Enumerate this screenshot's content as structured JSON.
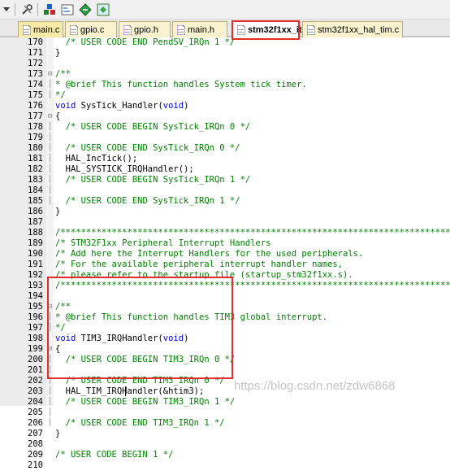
{
  "toolbar": {
    "buttons": [
      "dropdown-arrow",
      "tools-icon",
      "manage-components-icon",
      "layout-icon",
      "diamond-icon",
      "extension-icon"
    ]
  },
  "tabs": [
    {
      "label": "main.c",
      "type": "c"
    },
    {
      "label": "gpio.c",
      "type": "c"
    },
    {
      "label": "gpio.h",
      "type": "h"
    },
    {
      "label": "main.h",
      "type": "h"
    },
    {
      "label": "stm32f1xx_it.c",
      "type": "c",
      "active": true
    },
    {
      "label": "stm32f1xx_hal_tim.c",
      "type": "c"
    }
  ],
  "lines": [
    {
      "n": "170",
      "text": "  /* USER CODE END PendSV_IRQn 1 */"
    },
    {
      "n": "171",
      "text": "}"
    },
    {
      "n": "172",
      "text": ""
    },
    {
      "n": "173",
      "text": "/**"
    },
    {
      "n": "174",
      "text": "* @brief This function handles System tick timer."
    },
    {
      "n": "175",
      "text": "*/"
    },
    {
      "n": "176",
      "text": "void SysTick_Handler(void)"
    },
    {
      "n": "177",
      "text": "{"
    },
    {
      "n": "178",
      "text": "  /* USER CODE BEGIN SysTick_IRQn 0 */"
    },
    {
      "n": "179",
      "text": ""
    },
    {
      "n": "180",
      "text": "  /* USER CODE END SysTick_IRQn 0 */"
    },
    {
      "n": "181",
      "text": "  HAL_IncTick();"
    },
    {
      "n": "182",
      "text": "  HAL_SYSTICK_IRQHandler();"
    },
    {
      "n": "183",
      "text": "  /* USER CODE BEGIN SysTick_IRQn 1 */"
    },
    {
      "n": "184",
      "text": ""
    },
    {
      "n": "185",
      "text": "  /* USER CODE END SysTick_IRQn 1 */"
    },
    {
      "n": "186",
      "text": "}"
    },
    {
      "n": "187",
      "text": ""
    },
    {
      "n": "188",
      "text": "/******************************************************************************/"
    },
    {
      "n": "189",
      "text": "/* STM32F1xx Peripheral Interrupt Handlers                                    */"
    },
    {
      "n": "190",
      "text": "/* Add here the Interrupt Handlers for the used peripherals.                  */"
    },
    {
      "n": "191",
      "text": "/* For the available peripheral interrupt handler names,                      */"
    },
    {
      "n": "192",
      "text": "/* please refer to the startup file (startup_stm32f1xx.s).                    */"
    },
    {
      "n": "193",
      "text": "/******************************************************************************/"
    },
    {
      "n": "194",
      "text": ""
    },
    {
      "n": "195",
      "text": "/**"
    },
    {
      "n": "196",
      "text": "* @brief This function handles TIM3 global interrupt."
    },
    {
      "n": "197",
      "text": "*/"
    },
    {
      "n": "198",
      "text": "void TIM3_IRQHandler(void)"
    },
    {
      "n": "199",
      "text": "{"
    },
    {
      "n": "200",
      "text": "  /* USER CODE BEGIN TIM3_IRQn 0 */"
    },
    {
      "n": "201",
      "text": ""
    },
    {
      "n": "202",
      "text": "  /* USER CODE END TIM3_IRQn 0 */"
    },
    {
      "n": "203",
      "text": "  HAL_TIM_IRQHandler(&htim3);"
    },
    {
      "n": "204",
      "text": "  /* USER CODE BEGIN TIM3_IRQn 1 */"
    },
    {
      "n": "205",
      "text": ""
    },
    {
      "n": "206",
      "text": "  /* USER CODE END TIM3_IRQn 1 */"
    },
    {
      "n": "207",
      "text": "}"
    },
    {
      "n": "208",
      "text": ""
    },
    {
      "n": "209",
      "text": "/* USER CODE BEGIN 1 */"
    },
    {
      "n": "210",
      "text": ""
    }
  ],
  "watermark": "https://blog.csdn.net/zdw6868",
  "colors": {
    "comment": "#008000",
    "keyword": "#0000ff",
    "highlight_box": "#e32c2c",
    "tab_bg": "#f7e9a8"
  }
}
